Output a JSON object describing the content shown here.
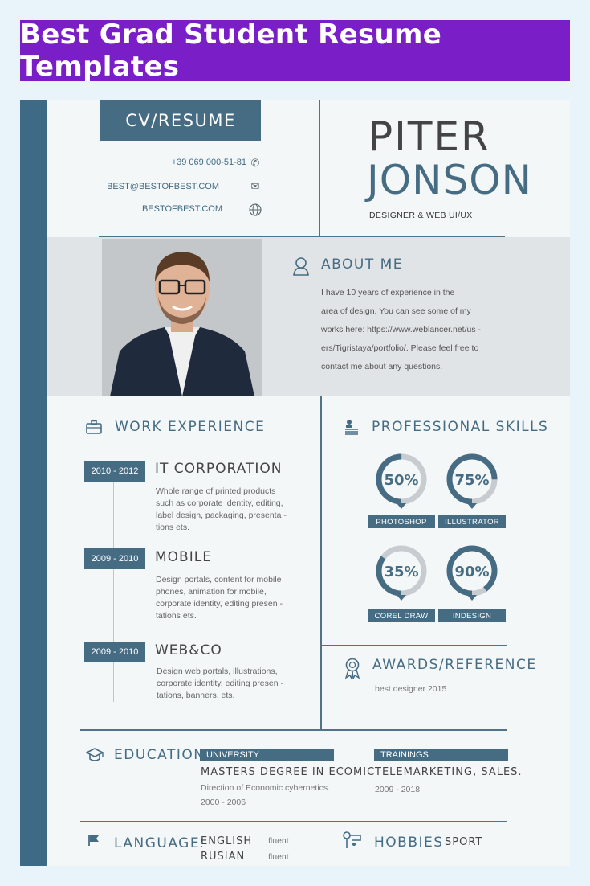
{
  "banner": {
    "title": "Best Grad Student Resume Templates"
  },
  "resume": {
    "cv_label": "CV/RESUME",
    "contact": {
      "phone": "+39 069 000-51-81",
      "email": "BEST@BESTOFBEST.COM",
      "website": "BESTOFBEST.COM"
    },
    "first_name": "PITER",
    "last_name": "JONSON",
    "job_title": "DESIGNER & WEB UI/UX",
    "about": {
      "heading": "ABOUT ME",
      "lines": [
        "I have 10 years of experience in the",
        "area of design. You can see some of my",
        "works here: https://www.weblancer.net/us -",
        "ers/Tigristaya/portfolio/. Please feel free to",
        "contact me about any questions."
      ]
    },
    "experience": {
      "heading": "WORK EXPERIENCE",
      "items": [
        {
          "dates": "2010 - 2012",
          "company": "IT CORPORATION",
          "lines": [
            "Whole range of printed products",
            "such as corporate identity, editing,",
            "label design, packaging, presenta -",
            "tions ets."
          ]
        },
        {
          "dates": "2009 - 2010",
          "company": "MOBILE",
          "lines": [
            "Design portals, content for mobile",
            "phones, animation for mobile,",
            "corporate identity, editing presen -",
            "tations ets."
          ]
        },
        {
          "dates": "2009 - 2010",
          "company": "WEB&CO",
          "lines": [
            "Design web portals, illustrations,",
            "corporate identity, editing presen -",
            "tations, banners, ets."
          ]
        }
      ]
    },
    "skills": {
      "heading": "PROFESSIONAL SKILLS",
      "items": [
        {
          "name": "PHOTOSHOP",
          "percent_label": "50%",
          "level": 50
        },
        {
          "name": "ILLUSTRATOR",
          "percent_label": "75%",
          "level": 75
        },
        {
          "name": "COREL DRAW",
          "percent_label": "35%",
          "level": 35
        },
        {
          "name": "INDESIGN",
          "percent_label": "90%",
          "level": 90
        }
      ]
    },
    "awards": {
      "heading": "AWARDS/REFERENCE",
      "text": "best designer 2015"
    },
    "education": {
      "heading": "EDUCATION",
      "university_label": "UNIVERSITY",
      "degree": "MASTERS DEGREE IN ECOMICS",
      "detail": "Direction of Economic cybernetics.",
      "years": "2000 - 2006",
      "trainings_label": "TRAININGS",
      "training": "TELEMARKETING, SALES.",
      "training_years": "2009 - 2018"
    },
    "languages": {
      "heading": "LANGUAGES",
      "items": [
        {
          "name": "ENGLISH",
          "level": "fluent"
        },
        {
          "name": "RUSIAN",
          "level": "fluent"
        }
      ]
    },
    "hobbies": {
      "heading": "HOBBIES",
      "items": [
        "SPORT"
      ]
    }
  },
  "colors": {
    "banner": "#7a1fc7",
    "accent": "#466c84",
    "sidebar": "#3e6a85",
    "page_bg": "#e8f4fa"
  }
}
